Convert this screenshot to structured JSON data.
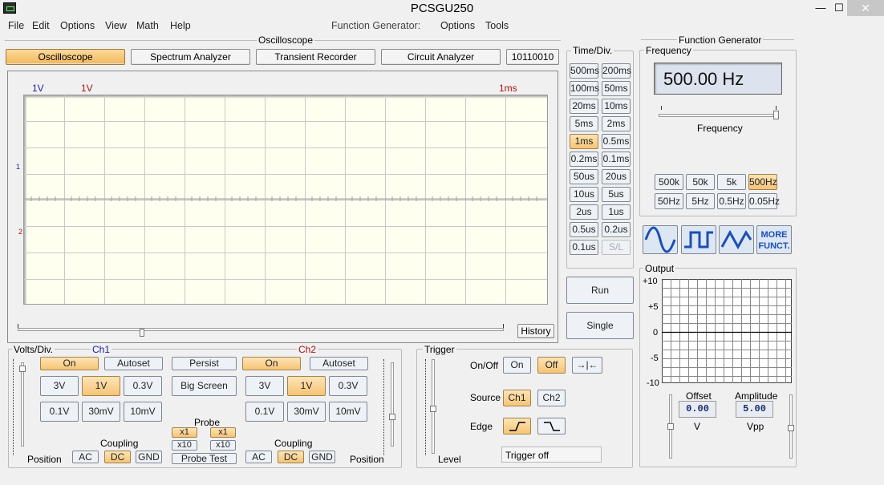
{
  "window": {
    "title": "PCSGU250",
    "min": "—",
    "max": "☐",
    "close": "✕"
  },
  "menu": {
    "file": "File",
    "edit": "Edit",
    "options": "Options",
    "view": "View",
    "math": "Math",
    "help": "Help",
    "fg_label": "Function Generator:",
    "fg_options": "Options",
    "fg_tools": "Tools"
  },
  "osc_group": "Oscilloscope",
  "tabs": {
    "oscilloscope": "Oscilloscope",
    "spectrum": "Spectrum Analyzer",
    "transient": "Transient Recorder",
    "circuit": "Circuit Analyzer",
    "code": "10110010"
  },
  "screen": {
    "ch1_volts": "1V",
    "ch2_volts": "1V",
    "time": "1ms",
    "marker1": "1",
    "marker2": "2",
    "history": "History"
  },
  "timediv": {
    "label": "Time/Div.",
    "buttons": [
      "500ms",
      "200ms",
      "100ms",
      "50ms",
      "20ms",
      "10ms",
      "5ms",
      "2ms",
      "1ms",
      "0.5ms",
      "0.2ms",
      "0.1ms",
      "50us",
      "20us",
      "10us",
      "5us",
      "2us",
      "1us",
      "0.5us",
      "0.2us",
      "0.1us",
      "S/L"
    ],
    "active": "1ms",
    "disabled": "S/L"
  },
  "run": "Run",
  "single": "Single",
  "volts": {
    "label": "Volts/Div.",
    "ch1": "Ch1",
    "ch2": "Ch2",
    "on": "On",
    "autoset": "Autoset",
    "persist": "Persist",
    "bigscreen": "Big Screen",
    "v3": "3V",
    "v1": "1V",
    "v03": "0.3V",
    "v01": "0.1V",
    "v30m": "30mV",
    "v10m": "10mV",
    "probe": "Probe",
    "x1": "x1",
    "x10": "x10",
    "probetest": "Probe Test",
    "coupling": "Coupling",
    "ac": "AC",
    "dc": "DC",
    "gnd": "GND",
    "position": "Position"
  },
  "trigger": {
    "label": "Trigger",
    "onoff": "On/Off",
    "on": "On",
    "off": "Off",
    "source": "Source",
    "ch1": "Ch1",
    "ch2": "Ch2",
    "edge": "Edge",
    "level": "Level",
    "status": "Trigger off",
    "center": "→|←"
  },
  "fg": {
    "label": "Function Generator",
    "freq_group": "Frequency",
    "freq_value": "500.00 Hz",
    "freq_slider": "Frequency",
    "ranges": [
      "500k",
      "50k",
      "5k",
      "500Hz",
      "50Hz",
      "5Hz",
      "0.5Hz",
      "0.05Hz"
    ],
    "active": "500Hz",
    "more1": "MORE",
    "more2": "FUNCT.",
    "output": "Output",
    "yticks": [
      "+10",
      "+5",
      "0",
      "-5",
      "-10"
    ],
    "offset_label": "Offset",
    "offset_value": "0.00",
    "offset_unit": "V",
    "amp_label": "Amplitude",
    "amp_value": "5.00",
    "amp_unit": "Vpp"
  },
  "colors": {
    "ch1": "#1c1ca0",
    "ch2": "#b01010",
    "active": "#f6c476"
  }
}
